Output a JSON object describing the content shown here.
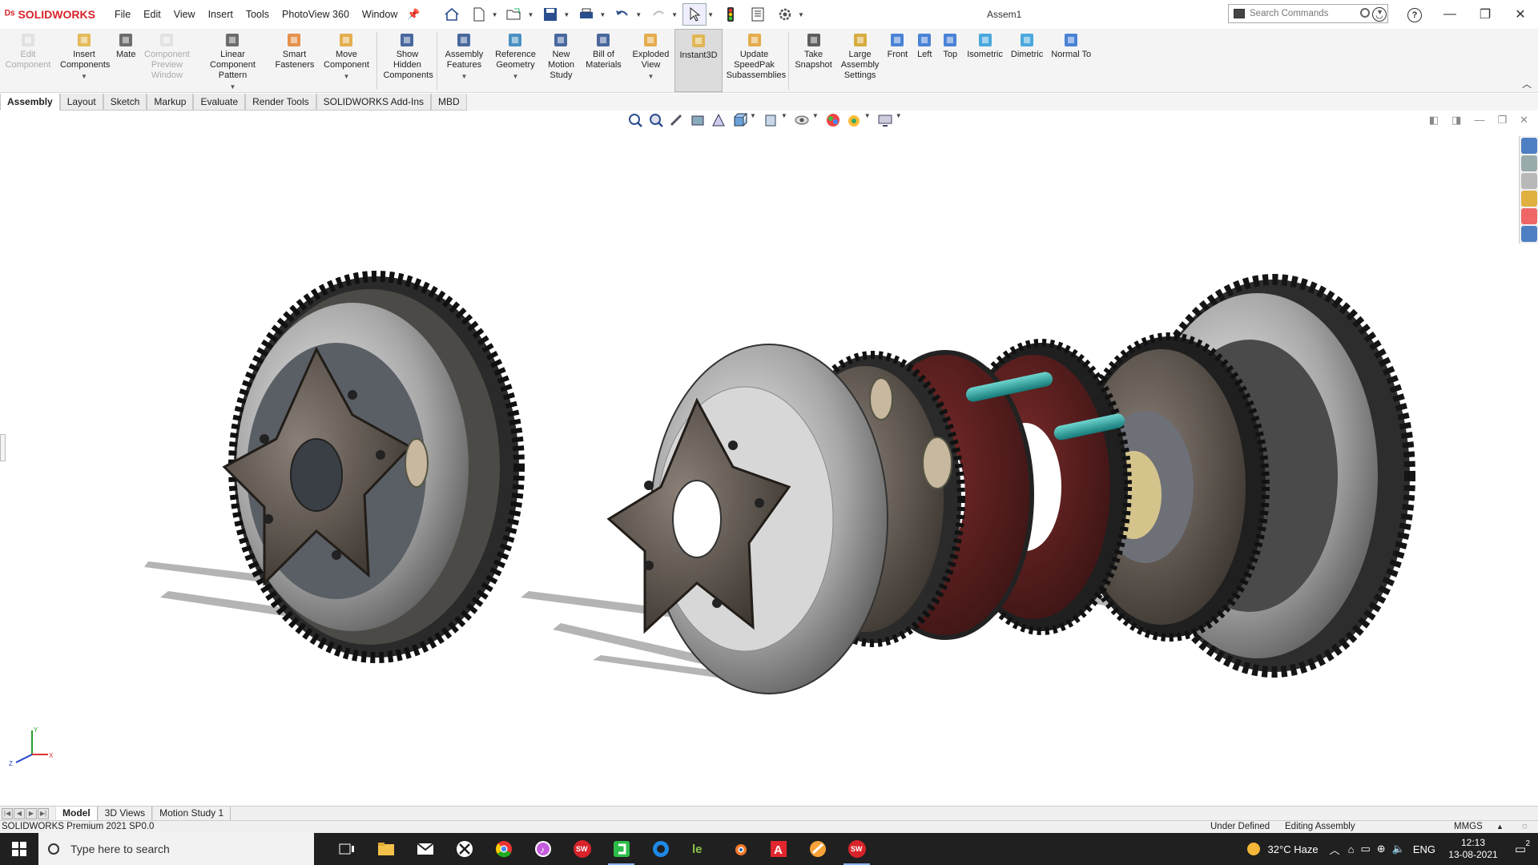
{
  "app": {
    "brand": "SOLIDWORKS",
    "doc_title": "Assem1"
  },
  "menu": [
    "File",
    "Edit",
    "View",
    "Insert",
    "Tools",
    "PhotoView 360",
    "Window"
  ],
  "search": {
    "placeholder": "Search Commands"
  },
  "ribbon": [
    {
      "label": "Edit Component",
      "icon": "edit-component-icon",
      "disabled": true
    },
    {
      "label": "Insert Components",
      "icon": "insert-components-icon",
      "caret": true
    },
    {
      "label": "Mate",
      "icon": "mate-icon"
    },
    {
      "label": "Component Preview Window",
      "icon": "component-preview-icon",
      "disabled": true
    },
    {
      "label": "Linear Component Pattern",
      "icon": "linear-pattern-icon",
      "caret": true
    },
    {
      "label": "Smart Fasteners",
      "icon": "smart-fasteners-icon"
    },
    {
      "label": "Move Component",
      "icon": "move-component-icon",
      "caret": true
    },
    {
      "label": "Show Hidden Components",
      "icon": "show-hidden-icon",
      "sep": true
    },
    {
      "label": "Assembly Features",
      "icon": "assembly-features-icon",
      "caret": true,
      "sep": true
    },
    {
      "label": "Reference Geometry",
      "icon": "reference-geometry-icon",
      "caret": true
    },
    {
      "label": "New Motion Study",
      "icon": "motion-study-icon"
    },
    {
      "label": "Bill of Materials",
      "icon": "bom-icon"
    },
    {
      "label": "Exploded View",
      "icon": "exploded-view-icon",
      "caret": true
    },
    {
      "label": "Instant3D",
      "icon": "instant3d-icon",
      "active": true
    },
    {
      "label": "Update SpeedPak Subassemblies",
      "icon": "speedpak-icon"
    },
    {
      "label": "Take Snapshot",
      "icon": "snapshot-icon",
      "sep": true
    },
    {
      "label": "Large Assembly Settings",
      "icon": "large-assembly-icon"
    },
    {
      "label": "Front",
      "icon": "front-view-icon"
    },
    {
      "label": "Left",
      "icon": "left-view-icon"
    },
    {
      "label": "Top",
      "icon": "top-view-icon"
    },
    {
      "label": "Isometric",
      "icon": "isometric-view-icon"
    },
    {
      "label": "Dimetric",
      "icon": "dimetric-view-icon"
    },
    {
      "label": "Normal To",
      "icon": "normal-to-icon"
    }
  ],
  "tabs": [
    "Assembly",
    "Layout",
    "Sketch",
    "Markup",
    "Evaluate",
    "Render Tools",
    "SOLIDWORKS Add-Ins",
    "MBD"
  ],
  "bottom_tabs": [
    "Model",
    "3D Views",
    "Motion Study 1"
  ],
  "status": {
    "left": "SOLIDWORKS Premium 2021 SP0.0",
    "state": "Under Defined",
    "mode": "Editing Assembly",
    "units": "MMGS"
  },
  "triad": {
    "y": "Y",
    "x": "X",
    "z": "Z"
  },
  "taskbar": {
    "search_placeholder": "Type here to search",
    "weather": "32°C  Haze",
    "lang": "ENG",
    "time": "12:13",
    "date": "13-08-2021",
    "notif": "2"
  },
  "colors": {
    "brand": "#d8232a",
    "ribbon_bg": "#f4f4f4",
    "taskbar_bg": "#202020"
  }
}
